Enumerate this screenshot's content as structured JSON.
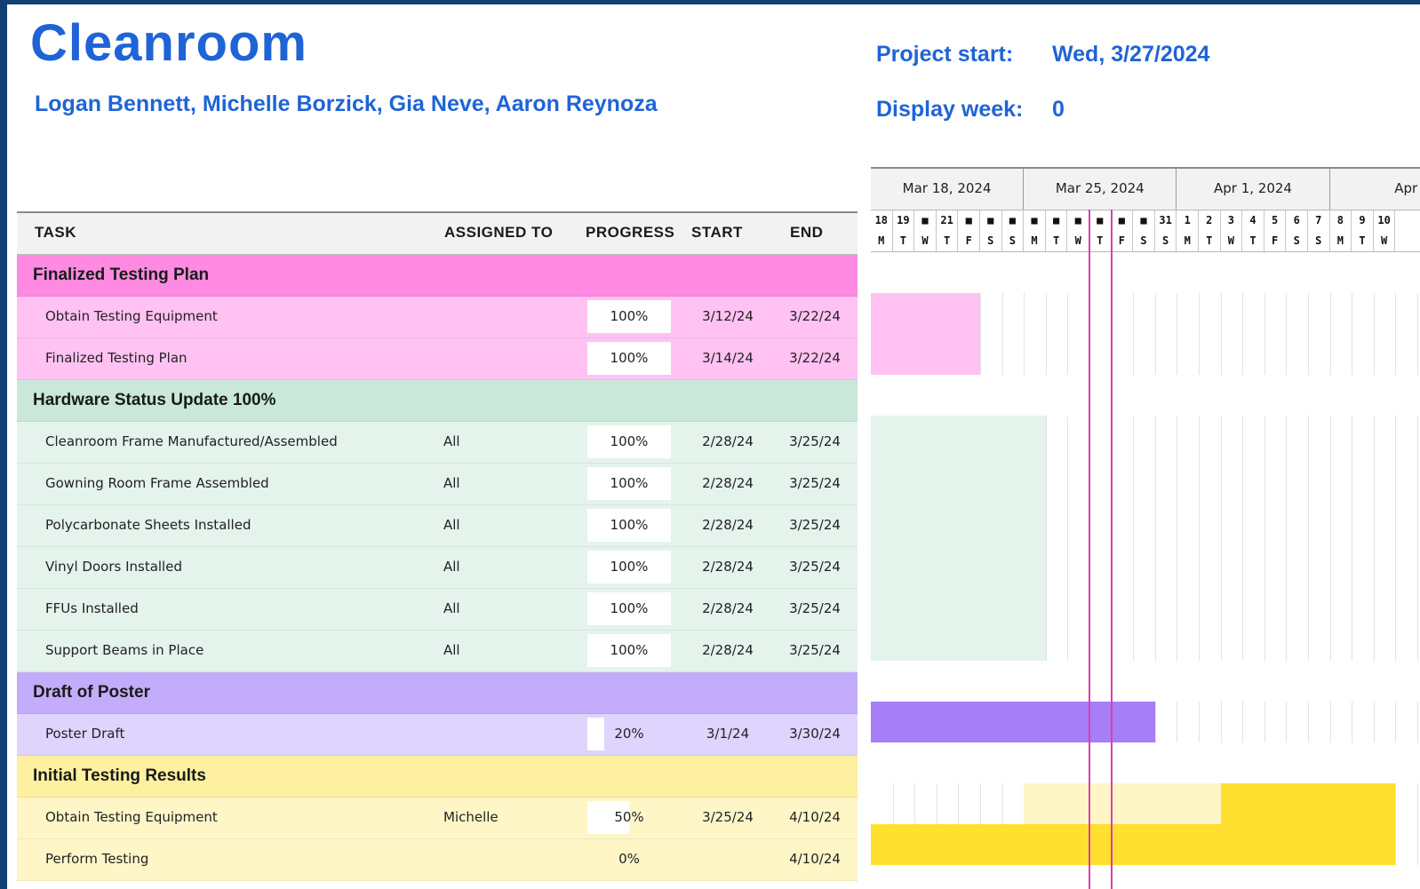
{
  "title": "Cleanroom",
  "authors": "Logan Bennett, Michelle Borzick, Gia Neve, Aaron Reynoza",
  "project_start": {
    "label": "Project start:",
    "value": "Wed, 3/27/2024"
  },
  "display_week": {
    "label": "Display week:",
    "value": "0"
  },
  "columns": {
    "task": "TASK",
    "assigned": "ASSIGNED TO",
    "progress": "PROGRESS",
    "start": "START",
    "end": "END"
  },
  "groups": [
    {
      "title": "Finalized Testing Plan",
      "header_color": "#ff8ae2",
      "row_color": "#ffc2f2",
      "bar_color": "#ffc2f2",
      "tasks": [
        {
          "task": "Obtain Testing Equipment",
          "assigned": "",
          "progress": "100%",
          "progress_value": 100,
          "start": "3/12/24",
          "end": "3/22/24"
        },
        {
          "task": "Finalized Testing Plan",
          "assigned": "",
          "progress": "100%",
          "progress_value": 100,
          "start": "3/14/24",
          "end": "3/22/24"
        }
      ]
    },
    {
      "title": "Hardware Status Update 100%",
      "header_color": "#c9e8d9",
      "row_color": "#e4f3ec",
      "bar_color": "#e4f3ec",
      "tasks": [
        {
          "task": "Cleanroom Frame Manufactured/Assembled",
          "assigned": "All",
          "progress": "100%",
          "progress_value": 100,
          "start": "2/28/24",
          "end": "3/25/24"
        },
        {
          "task": "Gowning Room Frame Assembled",
          "assigned": "All",
          "progress": "100%",
          "progress_value": 100,
          "start": "2/28/24",
          "end": "3/25/24"
        },
        {
          "task": "Polycarbonate Sheets Installed",
          "assigned": "All",
          "progress": "100%",
          "progress_value": 100,
          "start": "2/28/24",
          "end": "3/25/24"
        },
        {
          "task": "Vinyl Doors Installed",
          "assigned": "All",
          "progress": "100%",
          "progress_value": 100,
          "start": "2/28/24",
          "end": "3/25/24"
        },
        {
          "task": "FFUs Installed",
          "assigned": "All",
          "progress": "100%",
          "progress_value": 100,
          "start": "2/28/24",
          "end": "3/25/24"
        },
        {
          "task": "Support Beams in Place",
          "assigned": "All",
          "progress": "100%",
          "progress_value": 100,
          "start": "2/28/24",
          "end": "3/25/24"
        }
      ]
    },
    {
      "title": "Draft of Poster",
      "header_color": "#c3acfa",
      "row_color": "#dfd4fd",
      "bar_color": "#a67ef5",
      "tasks": [
        {
          "task": "Poster Draft",
          "assigned": "",
          "progress": "20%",
          "progress_value": 20,
          "start": "3/1/24",
          "end": "3/30/24"
        }
      ]
    },
    {
      "title": "Initial Testing Results",
      "header_color": "#fdf0a0",
      "row_color": "#fff6c8",
      "bar_color": "#ffe02e",
      "tasks": [
        {
          "task": "Obtain Testing Equipment",
          "assigned": "Michelle",
          "progress": "50%",
          "progress_value": 50,
          "start": "3/25/24",
          "end": "4/10/24"
        },
        {
          "task": "Perform Testing",
          "assigned": "",
          "progress": "0%",
          "progress_value": 0,
          "start": "",
          "end": "4/10/24"
        }
      ]
    }
  ],
  "gantt": {
    "weeks": [
      "Mar 18, 2024",
      "Mar 25, 2024",
      "Apr 1, 2024",
      "Apr"
    ],
    "days": [
      "18",
      "19",
      "■",
      "21",
      "■",
      "■",
      "■",
      "■",
      "■",
      "■",
      "■",
      "■",
      "■",
      "31",
      "1",
      "2",
      "3",
      "4",
      "5",
      "6",
      "7",
      "8",
      "9",
      "10"
    ],
    "weekdays": [
      "M",
      "T",
      "W",
      "T",
      "F",
      "S",
      "S",
      "M",
      "T",
      "W",
      "T",
      "F",
      "S",
      "S",
      "M",
      "T",
      "W",
      "T",
      "F",
      "S",
      "S",
      "M",
      "T",
      "W"
    ],
    "today_marker": "Mar 28, 2024"
  }
}
